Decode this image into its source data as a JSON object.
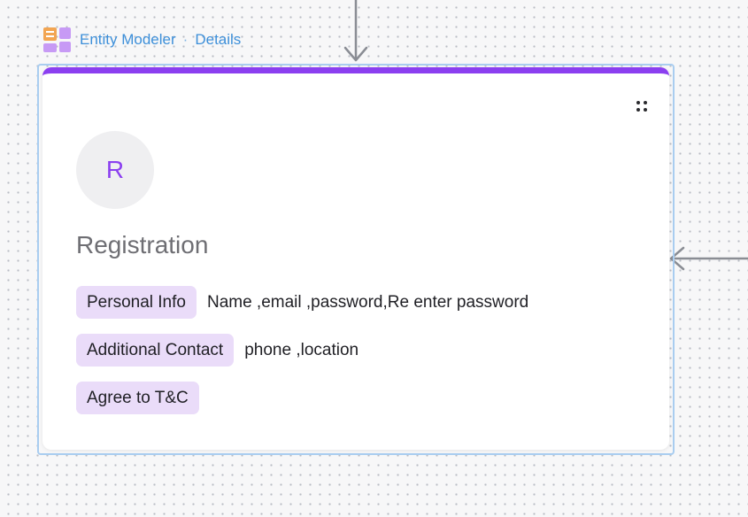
{
  "breadcrumb": {
    "app_name": "Entity Modeler",
    "separator": "·",
    "current": "Details"
  },
  "card": {
    "avatar_initial": "R",
    "title": "Registration",
    "rows": [
      {
        "label": "Personal Info",
        "value": "Name ,email ,password,Re enter password"
      },
      {
        "label": "Additional Contact",
        "value": "phone ,location"
      },
      {
        "label": "Agree to T&C",
        "value": ""
      }
    ]
  },
  "icons": {
    "app": "entity-modeler-app-icon",
    "drag": "drag-handle-icon",
    "connector_in_top": "arrow-down-icon",
    "connector_in_right": "arrow-left-icon"
  },
  "colors": {
    "accent": "#8b3ff0",
    "tag_bg": "#eadcf9",
    "link": "#3d8fd9",
    "selection": "#a9cdf0"
  }
}
